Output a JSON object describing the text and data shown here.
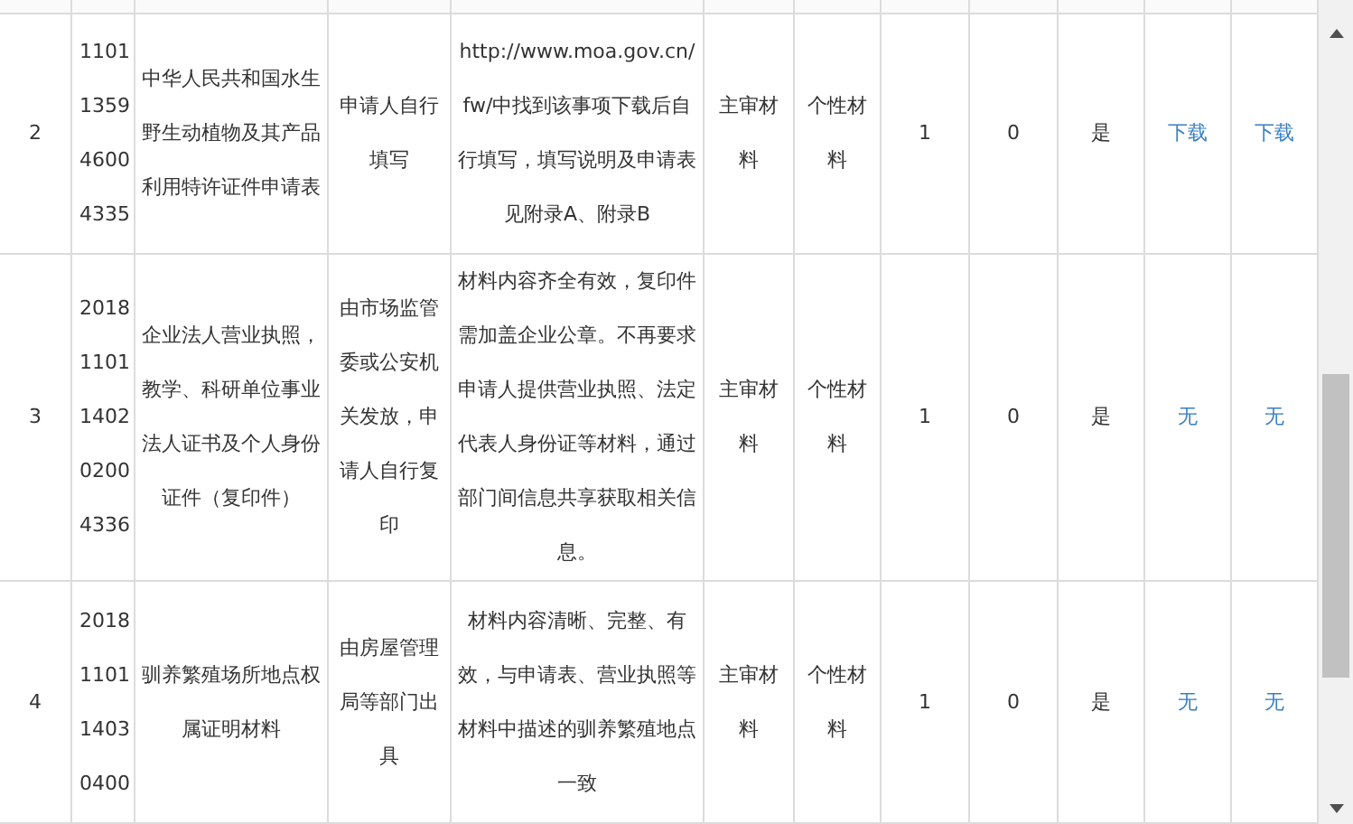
{
  "columns": [
    {
      "kind": "text"
    },
    {
      "kind": "text"
    },
    {
      "kind": "text"
    },
    {
      "kind": "text"
    },
    {
      "kind": "text"
    },
    {
      "kind": "text"
    },
    {
      "kind": "text"
    },
    {
      "kind": "text"
    },
    {
      "kind": "text"
    },
    {
      "kind": "text"
    },
    {
      "kind": "link"
    },
    {
      "kind": "link"
    }
  ],
  "rows": [
    {
      "cells": [
        "2",
        "1101135946004335",
        "中华人民共和国水生野生动植物及其产品利用特许证件申请表",
        "申请人自行填写",
        "http://www.moa.gov.cn/fw/中找到该事项下载后自行填写，填写说明及申请表见附录A、附录B",
        "主审材料",
        "个性材料",
        "1",
        "0",
        "是",
        "下载",
        "下载"
      ]
    },
    {
      "cells": [
        "3",
        "20181101140202004336",
        "企业法人营业执照，教学、科研单位事业法人证书及个人身份证件（复印件）",
        "由市场监管委或公安机关发放，申请人自行复印",
        "材料内容齐全有效，复印件需加盖企业公章。不再要求申请人提供营业执照、法定代表人身份证等材料，通过部门间信息共享获取相关信息。",
        "主审材料",
        "个性材料",
        "1",
        "0",
        "是",
        "无",
        "无"
      ]
    },
    {
      "cells": [
        "4",
        "2018110114030400",
        "驯养繁殖场所地点权属证明材料",
        "由房屋管理局等部门出具",
        "材料内容清晰、完整、有效，与申请表、营业执照等材料中描述的驯养繁殖地点一致",
        "主审材料",
        "个性材料",
        "1",
        "0",
        "是",
        "无",
        "无"
      ]
    }
  ]
}
